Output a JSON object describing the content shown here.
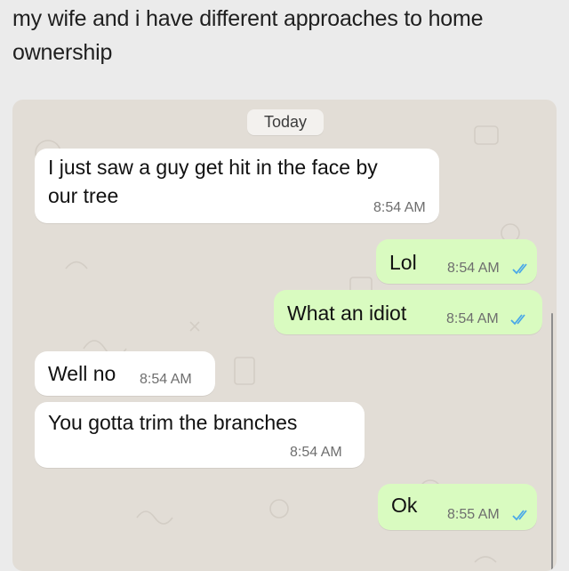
{
  "caption": "my wife and i have different approaches to home ownership",
  "chat": {
    "date_label": "Today",
    "colors": {
      "incoming_bubble": "#ffffff",
      "outgoing_bubble": "#d9fbc0",
      "background": "#e2ddd6",
      "read_ticks": "#4aa8e8"
    },
    "messages": [
      {
        "direction": "incoming",
        "text_line1": "I just saw a guy get hit in the face by",
        "text_line2": "our tree",
        "time": "8:54 AM"
      },
      {
        "direction": "outgoing",
        "text": "Lol",
        "time": "8:54 AM",
        "status": "read"
      },
      {
        "direction": "outgoing",
        "text": "What an idiot",
        "time": "8:54 AM",
        "status": "read"
      },
      {
        "direction": "incoming",
        "text": "Well no",
        "time": "8:54 AM"
      },
      {
        "direction": "incoming",
        "text": "You gotta trim the branches",
        "time": "8:54 AM"
      },
      {
        "direction": "outgoing",
        "text": "Ok",
        "time": "8:55 AM",
        "status": "read"
      }
    ]
  }
}
